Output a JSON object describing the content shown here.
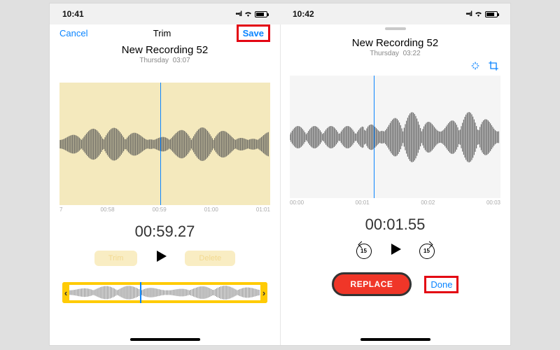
{
  "left": {
    "status": {
      "time": "10:41"
    },
    "nav": {
      "cancel": "Cancel",
      "title": "Trim",
      "save": "Save"
    },
    "recording": {
      "title": "New Recording 52",
      "day": "Thursday",
      "duration": "03:07"
    },
    "ruler": [
      "7",
      "00:58",
      "00:59",
      "01:00",
      "01:01"
    ],
    "bigtime": "00:59.27",
    "buttons": {
      "trim": "Trim",
      "delete": "Delete"
    },
    "scrubber_pct": 48,
    "trim_playhead_pct": 38
  },
  "right": {
    "status": {
      "time": "10:42"
    },
    "recording": {
      "title": "New Recording 52",
      "day": "Thursday",
      "duration": "03:22"
    },
    "ruler": [
      "00:00",
      "00:01",
      "00:02",
      "00:03"
    ],
    "bigtime": "00:01.55",
    "skip": "15",
    "replace": "REPLACE",
    "done": "Done",
    "scrubber_pct": 40
  }
}
